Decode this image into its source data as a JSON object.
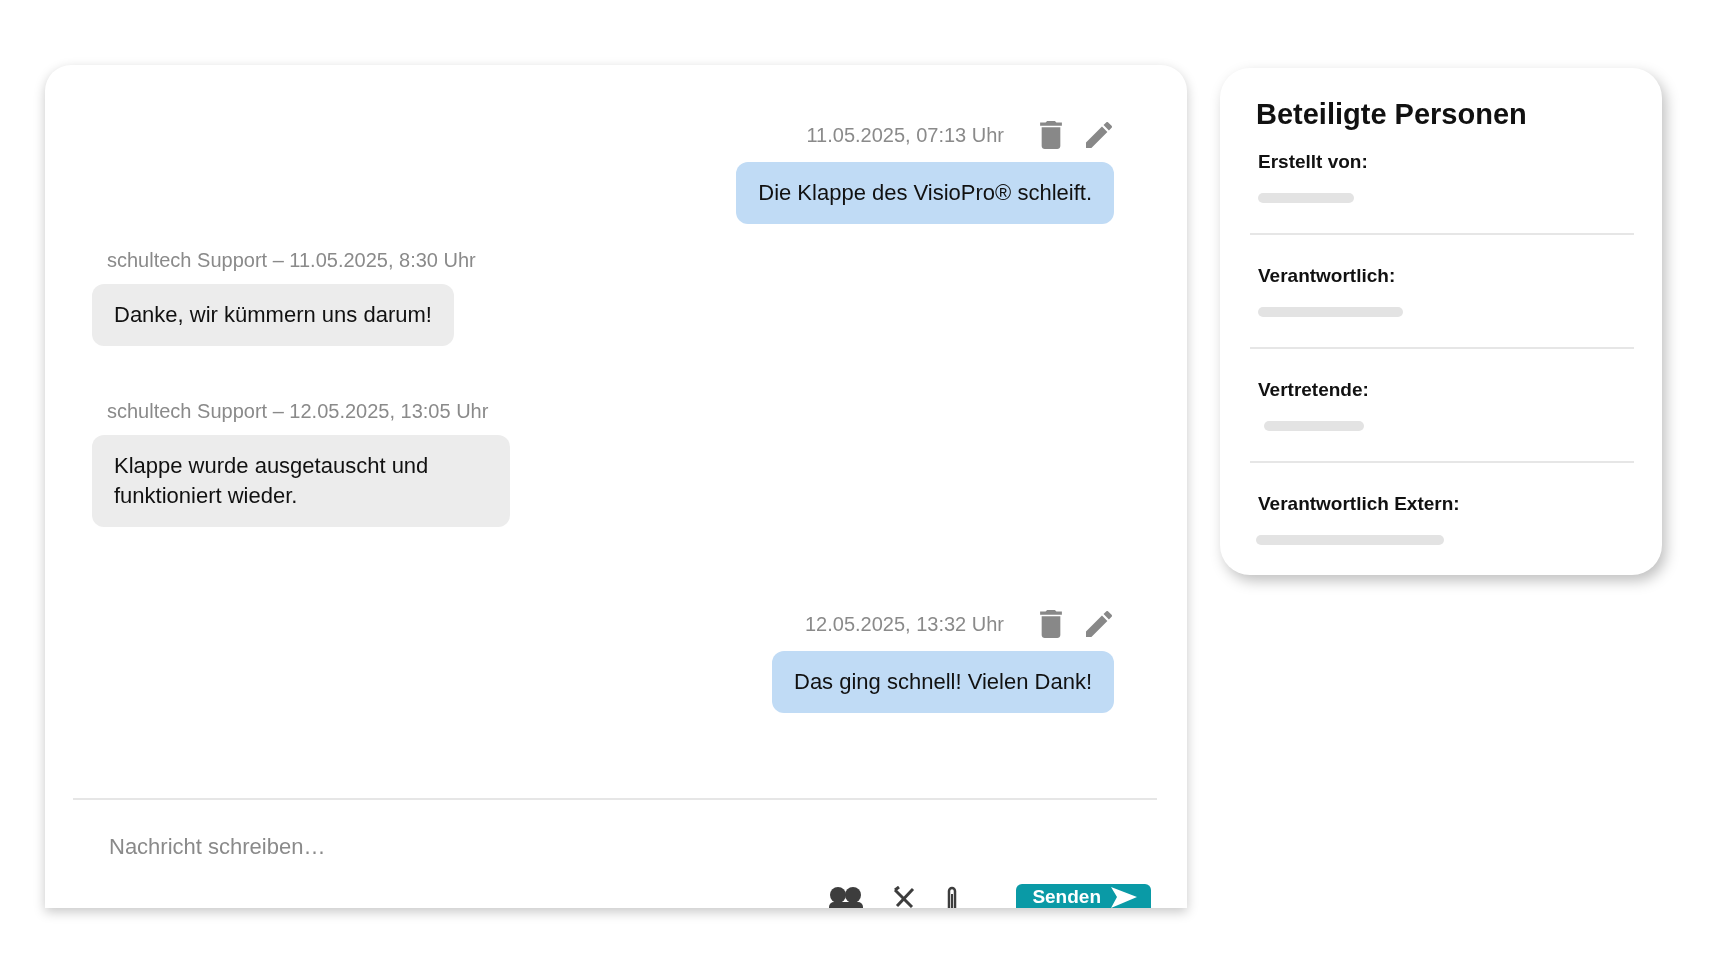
{
  "messages": [
    {
      "kind": "own",
      "meta": "11.05.2025, 07:13 Uhr",
      "text": "Die Klappe des VisioPro® schleift."
    },
    {
      "kind": "other",
      "meta": "schultech Support – 11.05.2025, 8:30 Uhr",
      "text": "Danke, wir kümmern uns darum!"
    },
    {
      "kind": "other",
      "meta": "schultech Support – 12.05.2025, 13:05 Uhr",
      "text": "Klappe wurde ausgetauscht und funktioniert wieder."
    },
    {
      "kind": "own",
      "meta": "12.05.2025, 13:32 Uhr",
      "text": "Das ging schnell! Vielen Dank!"
    }
  ],
  "composer": {
    "placeholder": "Nachricht schreiben…",
    "send_label": "Senden"
  },
  "participants": {
    "title": "Beteiligte Personen",
    "fields": [
      {
        "label": "Erstellt von:"
      },
      {
        "label": "Verantwortlich:"
      },
      {
        "label": "Vertretende:"
      },
      {
        "label": "Verantwortlich Extern:"
      }
    ]
  }
}
